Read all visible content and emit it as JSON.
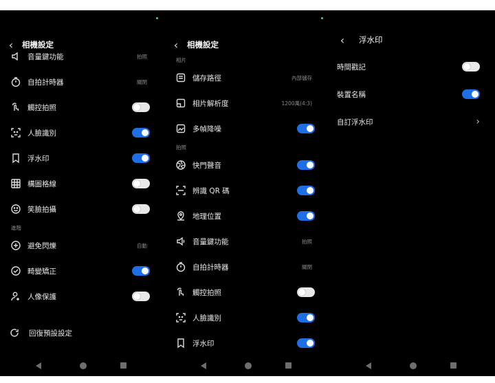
{
  "screen1": {
    "title": "相機設定",
    "rows": [
      {
        "label": "音量鍵功能",
        "value": "拍照"
      },
      {
        "label": "自拍計時器",
        "value": "關閉"
      },
      {
        "label": "觸控拍照",
        "toggle": "off"
      },
      {
        "label": "人臉識別",
        "toggle": "on"
      },
      {
        "label": "浮水印",
        "toggle": "on"
      },
      {
        "label": "構圖格線",
        "toggle": "off"
      },
      {
        "label": "笑臉拍攝",
        "toggle": "off"
      }
    ],
    "section_advanced": "進階",
    "adv_rows": [
      {
        "label": "避免閃爍",
        "value": "自動"
      },
      {
        "label": "畸變矯正",
        "toggle": "on"
      },
      {
        "label": "人像保護",
        "toggle": "off"
      }
    ],
    "reset_label": "回復預設設定"
  },
  "screen2": {
    "title": "相機設定",
    "section_photo": "相片",
    "photo_rows": [
      {
        "label": "儲存路徑",
        "value": "內部儲存"
      },
      {
        "label": "相片解析度",
        "value": "1200萬(4:3)"
      },
      {
        "label": "多幀降噪",
        "toggle": "on"
      }
    ],
    "section_shoot": "拍照",
    "shoot_rows": [
      {
        "label": "快門聲音",
        "toggle": "on"
      },
      {
        "label": "辨識 QR 碼",
        "toggle": "on"
      },
      {
        "label": "地理位置",
        "toggle": "on"
      },
      {
        "label": "音量鍵功能",
        "value": "拍照"
      },
      {
        "label": "自拍計時器",
        "value": "關閉"
      },
      {
        "label": "觸控拍照",
        "toggle": "off"
      },
      {
        "label": "人臉識別",
        "toggle": "on"
      },
      {
        "label": "浮水印",
        "toggle": "on"
      }
    ]
  },
  "screen3": {
    "title": "浮水印",
    "rows": [
      {
        "label": "時間戳記",
        "toggle": "off"
      },
      {
        "label": "裝置名稱",
        "toggle": "on"
      },
      {
        "label": "自訂浮水印"
      }
    ]
  },
  "colors": {
    "accent": "#1e6fe5",
    "background": "#000000"
  },
  "icons": [
    "back-icon",
    "volume-key-icon",
    "timer-icon",
    "touch-icon",
    "face-icon",
    "watermark-icon",
    "grid-icon",
    "smile-icon",
    "flicker-icon",
    "distortion-icon",
    "portrait-icon",
    "reset-icon",
    "storage-icon",
    "resolution-icon",
    "denoise-icon",
    "shutter-icon",
    "qr-icon",
    "location-icon",
    "chevron-right-icon"
  ]
}
